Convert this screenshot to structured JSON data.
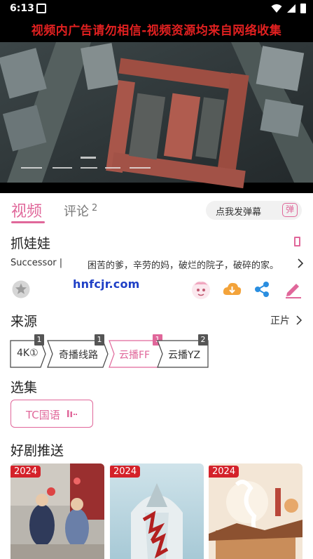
{
  "status_bar": {
    "time": "6:13"
  },
  "notice": "视频内广告请勿相信-视频资源均来自网络收集",
  "tabs": {
    "video": "视频",
    "comment": "评论",
    "comment_count": "2",
    "danmaku_prompt": "点我发弹幕",
    "danmaku_badge": "弹"
  },
  "show": {
    "title": "抓娃娃",
    "english_title": "Successor |",
    "description": "困苦的爹，辛劳的妈，破烂的院子，破碎的家。"
  },
  "watermark": "hnfcjr.com",
  "source_section": {
    "heading": "来源",
    "version": "正片",
    "sources": [
      {
        "label": "4K①",
        "count": "1",
        "active": false
      },
      {
        "label": "奇播线路",
        "count": "1",
        "active": false
      },
      {
        "label": "云播FF",
        "count": "1",
        "active": true
      },
      {
        "label": "云播YZ",
        "count": "2",
        "active": false
      }
    ]
  },
  "episode_section": {
    "heading": "选集",
    "episodes": [
      {
        "label": "TC国语",
        "playing": true
      }
    ]
  },
  "recommend_section": {
    "heading": "好剧推送",
    "cards": [
      {
        "year": "2024"
      },
      {
        "year": "2024"
      },
      {
        "year": "2024"
      }
    ]
  },
  "colors": {
    "accent": "#e0679a",
    "notice_red": "#e02020",
    "download_orange": "#f3a33a",
    "share_blue": "#2a8ee0",
    "badge_red": "#d4222a"
  }
}
